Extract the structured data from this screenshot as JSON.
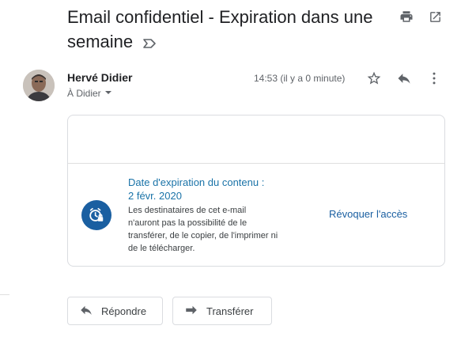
{
  "message": {
    "subject": "Email confidentiel - Expiration dans une semaine",
    "sender_name": "Hervé Didier",
    "recipient": "À Didier",
    "time": "14:53 (il y a 0 minute)"
  },
  "confidential_card": {
    "title": "Date d'expiration du contenu :",
    "date": "2 févr. 2020",
    "description": "Les destinataires de cet e-mail n'auront pas la possibilité de le transférer, de le copier, de l'imprimer ni de le télécharger.",
    "revoke_label": "Révoquer l'accès"
  },
  "actions": {
    "reply_label": "Répondre",
    "forward_label": "Transférer"
  },
  "colors": {
    "accent_blue": "#1a5fa1",
    "link_blue": "#1a73a8",
    "icon_gray": "#5f6368"
  },
  "icons": [
    "label-icon",
    "print-icon",
    "open-new-window-icon",
    "avatar",
    "star-icon",
    "reply-icon",
    "more-vert-icon",
    "chevron-down-icon",
    "clock-lock-icon",
    "forward-icon"
  ]
}
